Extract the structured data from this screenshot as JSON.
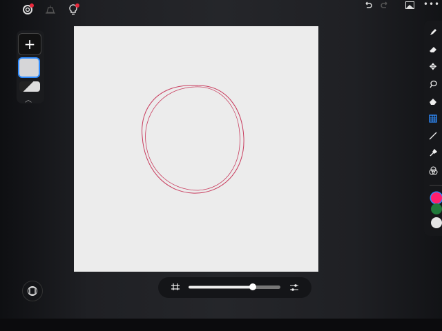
{
  "app": {
    "accent": "#2f8cff",
    "notification_color": "#e8283c"
  },
  "top_bar": {
    "left_icons": [
      "gallery-swirl-icon",
      "bell-stack-icon",
      "lightbulb-icon"
    ],
    "right_icons": [
      "undo-icon",
      "redo-icon",
      "image-icon",
      "more-icon"
    ]
  },
  "layers_panel": {
    "add_icon": "plus-icon",
    "expand_icon": "chevron-up-icon"
  },
  "tools": [
    "brush",
    "eraser",
    "move",
    "lasso",
    "fill",
    "perspective-grid",
    "line",
    "eyedropper",
    "blend"
  ],
  "active_tool": "perspective-grid",
  "colors": {
    "primary": "#ff1f6e",
    "secondary": "#1f7a3a",
    "tertiary": "#e6e6e6"
  },
  "stroke_color": "#c83a5c",
  "slider": {
    "value_percent": 70
  }
}
